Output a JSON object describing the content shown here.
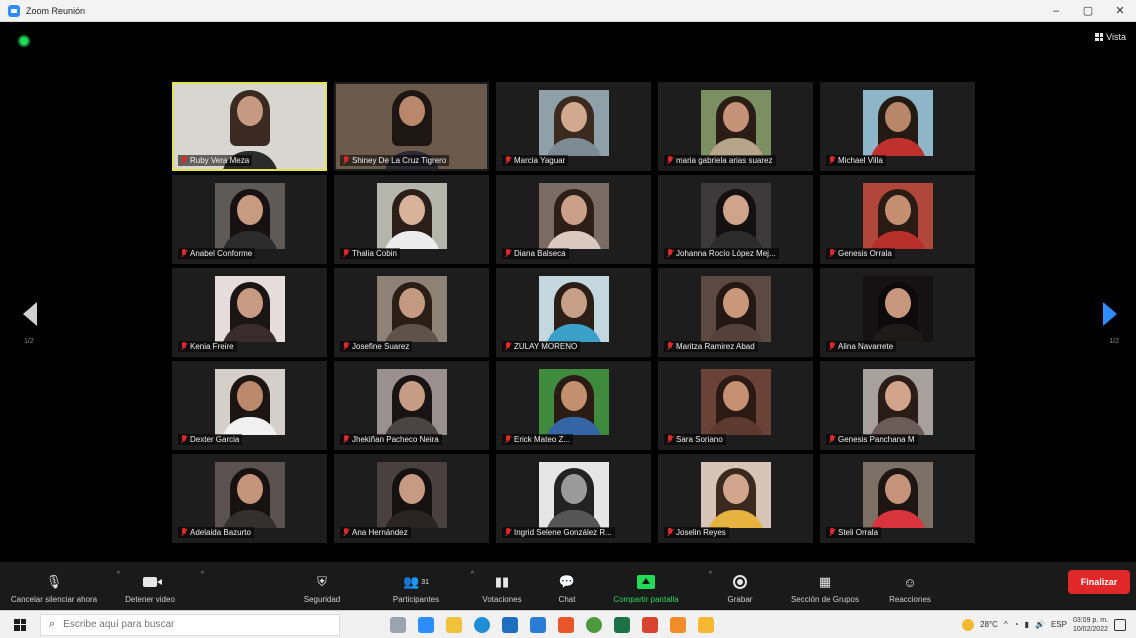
{
  "window": {
    "title": "Zoom Reunión",
    "controls": [
      "–",
      "▢",
      "✕"
    ]
  },
  "view_button": {
    "label": "Vista"
  },
  "pages": {
    "left": "1/2",
    "right": "1/2"
  },
  "participants": [
    {
      "name": "Ruby Vera Meza",
      "bg": "#d8d6d0",
      "skin": "#c59a80",
      "hair": "#3a2a22",
      "body": "#2b2b2b",
      "active": true,
      "wide": true
    },
    {
      "name": "Shiney De La Cruz Tigrero",
      "bg": "#6b5a4c",
      "skin": "#b9876b",
      "hair": "#1e1612",
      "body": "#2e2a35",
      "active": false,
      "wide": true
    },
    {
      "name": "Marcia Yaguar",
      "bg": "#8fa0a8",
      "skin": "#d1a98e",
      "hair": "#3b2a20",
      "body": "#7b8a93",
      "active": false,
      "wide": false
    },
    {
      "name": "maria gabriela arias suarez",
      "bg": "#7b8f63",
      "skin": "#c49377",
      "hair": "#2a1d16",
      "body": "#b7a589",
      "active": false,
      "wide": false
    },
    {
      "name": "Michael Villa",
      "bg": "#8fb6c8",
      "skin": "#b88669",
      "hair": "#241a14",
      "body": "#c0302c",
      "active": false,
      "wide": false
    },
    {
      "name": "Anabel Conforme",
      "bg": "#5e5a57",
      "skin": "#c89a7f",
      "hair": "#171211",
      "body": "#2c2c2c",
      "active": false,
      "wide": false
    },
    {
      "name": "Thalia Cobin",
      "bg": "#b4b6ab",
      "skin": "#d8b19b",
      "hair": "#2a1f19",
      "body": "#ececec",
      "active": false,
      "wide": false
    },
    {
      "name": "Diana Balseca",
      "bg": "#7a6c62",
      "skin": "#caa089",
      "hair": "#2d1f17",
      "body": "#d9c9bf",
      "active": false,
      "wide": false
    },
    {
      "name": "Johanna Rocío López Mej...",
      "bg": "#3c3a3a",
      "skin": "#cfa48b",
      "hair": "#141010",
      "body": "#2c2c2c",
      "active": false,
      "wide": false
    },
    {
      "name": "Genesis Orrala",
      "bg": "#b0473a",
      "skin": "#c58e70",
      "hair": "#2a1c15",
      "body": "#b82f2a",
      "active": false,
      "wide": false
    },
    {
      "name": "Kenia Freire",
      "bg": "#e6dcdc",
      "skin": "#c79a82",
      "hair": "#1c1515",
      "body": "#3a2c2c",
      "active": false,
      "wide": false
    },
    {
      "name": "Josefine Suarez",
      "bg": "#8c8276",
      "skin": "#c49a82",
      "hair": "#2a1e17",
      "body": "#5f5248",
      "active": false,
      "wide": false
    },
    {
      "name": "ZULAY MORENO",
      "bg": "#c4d6de",
      "skin": "#c79f86",
      "hair": "#2b1e17",
      "body": "#3aa0c8",
      "active": false,
      "wide": false
    },
    {
      "name": "Maritza Ramirez Abad",
      "bg": "#5b4a42",
      "skin": "#c9977a",
      "hair": "#231813",
      "body": "#54413a",
      "active": false,
      "wide": false
    },
    {
      "name": "Alina Navarrete",
      "bg": "#141212",
      "skin": "#c6977d",
      "hair": "#0c0a0a",
      "body": "#1e1a1a",
      "active": false,
      "wide": false
    },
    {
      "name": "Dexter Garcia",
      "bg": "#d4cfc9",
      "skin": "#bb8a6d",
      "hair": "#1d1511",
      "body": "#f0f0f0",
      "active": false,
      "wide": false
    },
    {
      "name": "Jhekiñan Pacheco Neira",
      "bg": "#9a9090",
      "skin": "#c79c85",
      "hair": "#1a1313",
      "body": "#4a4444",
      "active": false,
      "wide": false
    },
    {
      "name": "Erick Mateo Z...",
      "bg": "#3f8a3d",
      "skin": "#c2906f",
      "hair": "#2a1c15",
      "body": "#3465a4",
      "active": false,
      "wide": false
    },
    {
      "name": "Sara Soriano",
      "bg": "#6a4238",
      "skin": "#c68f72",
      "hair": "#2b1a14",
      "body": "#5c3a30",
      "active": false,
      "wide": false
    },
    {
      "name": "Genesis Panchana M",
      "bg": "#a7a09c",
      "skin": "#d1a48b",
      "hair": "#2a1d18",
      "body": "#6b5c58",
      "active": false,
      "wide": false
    },
    {
      "name": "Adelaida Bazurto",
      "bg": "#5b5150",
      "skin": "#c4957b",
      "hair": "#171211",
      "body": "#34302f",
      "active": false,
      "wide": false
    },
    {
      "name": "Ana Hernández",
      "bg": "#4a4040",
      "skin": "#c79b83",
      "hair": "#161111",
      "body": "#2a2424",
      "active": false,
      "wide": false
    },
    {
      "name": "Ingrid Selene González R...",
      "bg": "#e6e6e6",
      "skin": "#9a9a9a",
      "hair": "#222222",
      "body": "#555555",
      "active": false,
      "wide": false
    },
    {
      "name": "Joselin Reyes",
      "bg": "#d6c4b8",
      "skin": "#d2a68d",
      "hair": "#3a2a20",
      "body": "#e6b341",
      "active": false,
      "wide": false
    },
    {
      "name": "Steli Orrala",
      "bg": "#7c6f66",
      "skin": "#c4937a",
      "hair": "#1e1612",
      "body": "#d9333d",
      "active": false,
      "wide": false
    }
  ],
  "toolbar": {
    "mute": "Cancelar silenciar ahora",
    "video": "Detener video",
    "security": "Seguridad",
    "participants": "Participantes",
    "participants_count": "31",
    "polls": "Votaciones",
    "chat": "Chat",
    "share": "Compartir pantalla",
    "record": "Grabar",
    "breakout": "Sección de Grupos",
    "reactions": "Reacciones",
    "end": "Finalizar"
  },
  "taskbar": {
    "search_placeholder": "Escribe aquí para buscar",
    "temperature": "28°C",
    "language": "ESP",
    "time": "03:09 p. m.",
    "date": "10/02/2022"
  },
  "colors": {
    "active_border": "#e7e44a",
    "end_button": "#e02828",
    "share_green": "#23d959",
    "nav_blue": "#2d8cff"
  }
}
